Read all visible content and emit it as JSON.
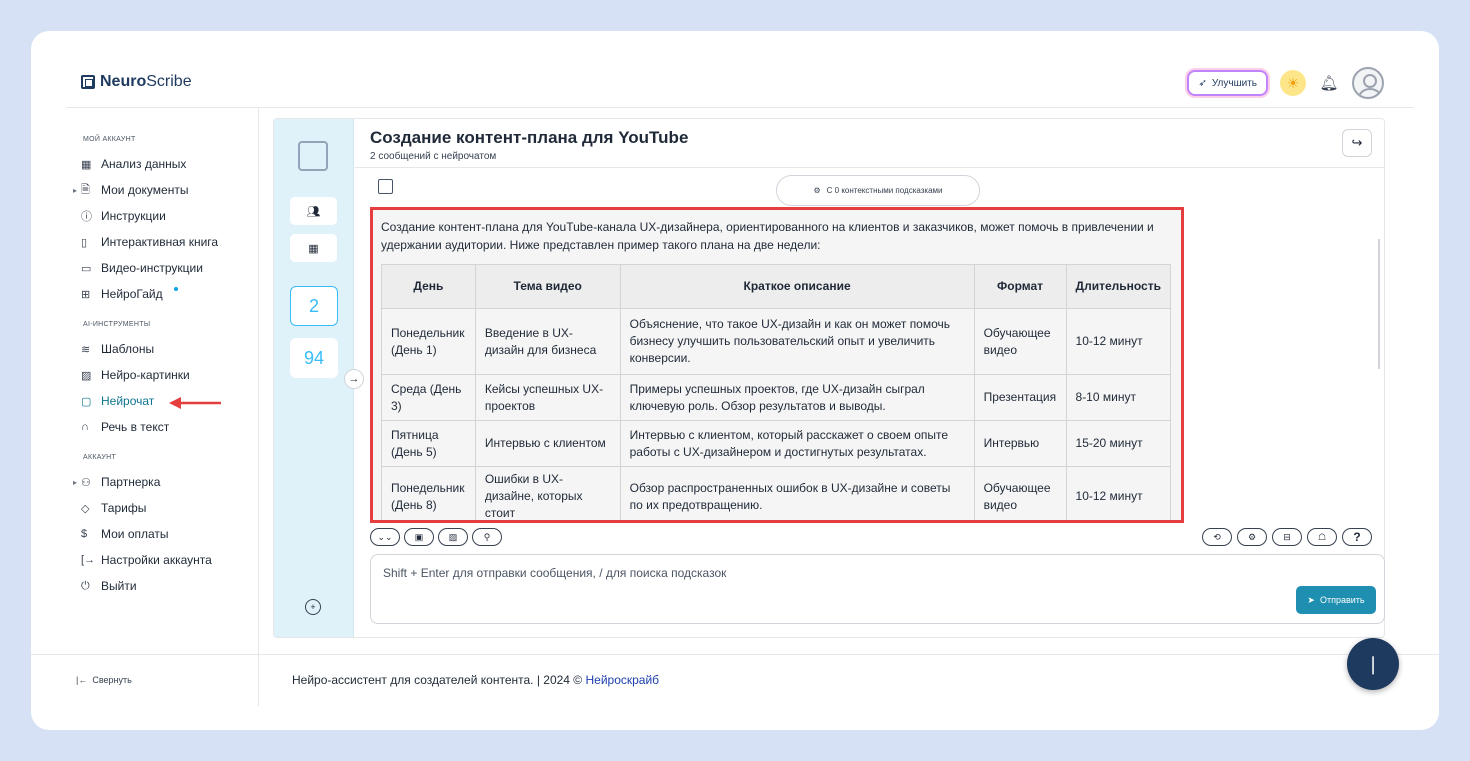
{
  "app": {
    "brand_bold": "Neuro",
    "brand_rest": "Scribe",
    "upgrade_label": "Улучшить"
  },
  "sidebar": {
    "sections": [
      {
        "title": "МОЙ АККАУНТ",
        "items": [
          {
            "label": "Анализ данных",
            "icon": "grid-icon"
          },
          {
            "label": "Мои документы",
            "icon": "document-icon"
          },
          {
            "label": "Инструкции",
            "icon": "help-circle-icon"
          },
          {
            "label": "Интерактивная книга",
            "icon": "book-icon"
          },
          {
            "label": "Видео-инструкции",
            "icon": "video-icon"
          },
          {
            "label": "НейроГайд",
            "icon": "layout-icon"
          }
        ]
      },
      {
        "title": "AI-ИНСТРУМЕНТЫ",
        "items": [
          {
            "label": "Шаблоны",
            "icon": "layers-icon"
          },
          {
            "label": "Нейро-картинки",
            "icon": "image-icon"
          },
          {
            "label": "Нейрочат",
            "icon": "chat-icon"
          },
          {
            "label": "Речь в текст",
            "icon": "headphones-icon"
          }
        ]
      },
      {
        "title": "АККАУНТ",
        "items": [
          {
            "label": "Партнерка",
            "icon": "users-icon"
          },
          {
            "label": "Тарифы",
            "icon": "tag-icon"
          },
          {
            "label": "Мои оплаты",
            "icon": "dollar-icon"
          },
          {
            "label": "Настройки аккаунта",
            "icon": "login-icon"
          },
          {
            "label": "Выйти",
            "icon": "power-icon"
          }
        ]
      }
    ],
    "collapse_label": "Свернуть"
  },
  "chat": {
    "title": "Создание контент-плана для YouTube",
    "subtitle": "2 сообщений с нейрочатом",
    "hints_label": "С 0 контекстными подсказками",
    "count_selected": "2",
    "count_other": "94",
    "message_intro": "Создание контент-плана для YouTube-канала UX-дизайнера, ориентированного на клиентов и заказчиков, может помочь в привлечении и удержании аудитории. Ниже представлен пример такого плана на две недели:",
    "table": {
      "headers": [
        "День",
        "Тема видео",
        "Краткое описание",
        "Формат",
        "Длительность"
      ],
      "rows": [
        [
          "Понедельник (День 1)",
          "Введение в UX-дизайн для бизнеса",
          "Объяснение, что такое UX-дизайн и как он может помочь бизнесу улучшить пользовательский опыт и увеличить конверсии.",
          "Обучающее видео",
          "10-12 минут"
        ],
        [
          "Среда (День 3)",
          "Кейсы успешных UX-проектов",
          "Примеры успешных проектов, где UX-дизайн сыграл ключевую роль. Обзор результатов и выводы.",
          "Презентация",
          "8-10 минут"
        ],
        [
          "Пятница (День 5)",
          "Интервью с клиентом",
          "Интервью с клиентом, который расскажет о своем опыте работы с UX-дизайнером и достигнутых результатах.",
          "Интервью",
          "15-20 минут"
        ],
        [
          "Понедельник (День 8)",
          "Ошибки в UX-дизайне, которых стоит",
          "Обзор распространенных ошибок в UX-дизайне и советы по их предотвращению.",
          "Обучающее видео",
          "10-12 минут"
        ]
      ]
    },
    "input_placeholder": "Shift + Enter для отправки сообщения, / для поиска подсказок",
    "send_label": "Отправить",
    "help_label": "?"
  },
  "footer": {
    "text": "Нейро-ассистент для создателей контента.  | 2024 ©",
    "link": "Нейроскрайб"
  }
}
